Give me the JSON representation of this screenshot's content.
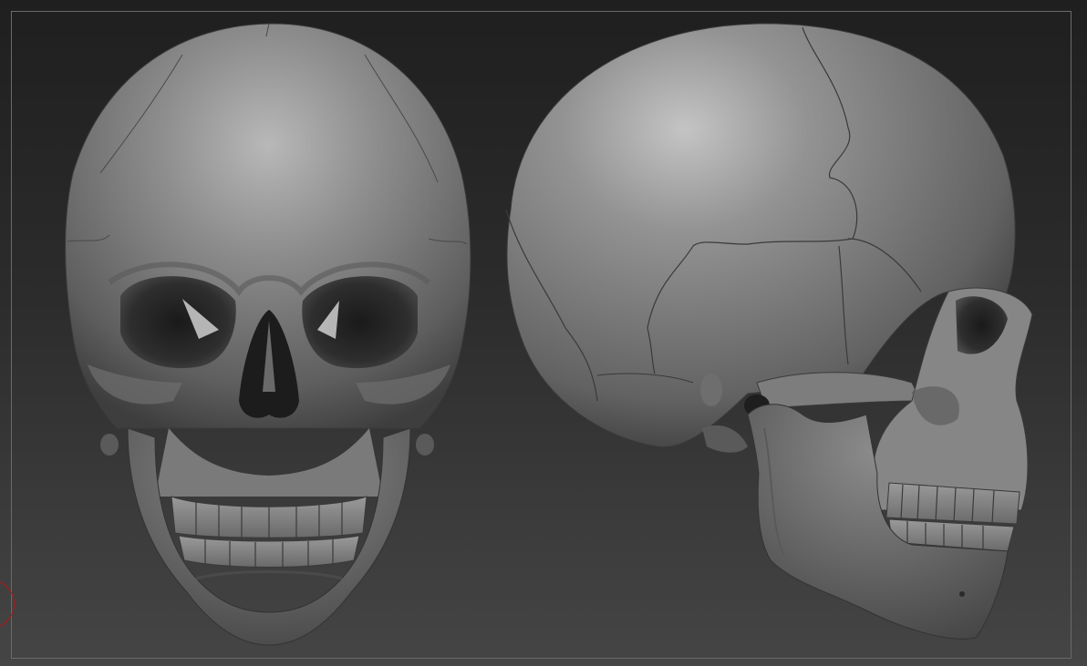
{
  "viewport": {
    "background_top": "#1f1f1f",
    "background_bottom": "#454545",
    "frame_color": "#6a6a6a",
    "cursor_color": "#b01818"
  },
  "models": [
    {
      "view": "front",
      "material_color": "#8a8a8a"
    },
    {
      "view": "side",
      "material_color": "#8a8a8a"
    }
  ]
}
